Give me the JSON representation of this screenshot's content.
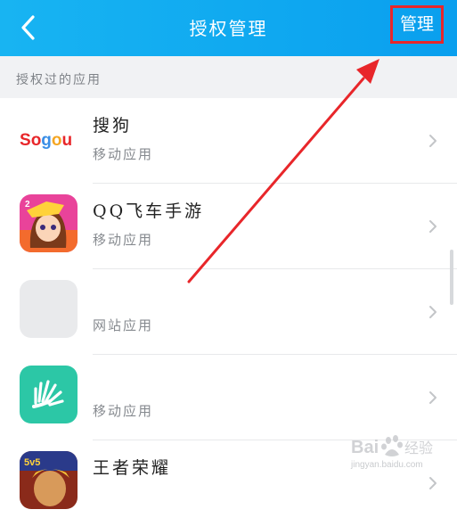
{
  "header": {
    "title": "授权管理",
    "back_icon": "chevron-left-icon",
    "manage_label": "管理"
  },
  "section": {
    "title": "授权过的应用"
  },
  "apps": [
    {
      "name": "搜狗",
      "type": "移动应用",
      "icon": "sogou-logo",
      "logo_text": "Sogou"
    },
    {
      "name": "QQ飞车手游",
      "type": "移动应用",
      "icon": "qq-speed-game-icon"
    },
    {
      "name": "",
      "type": "网站应用",
      "icon": "placeholder-icon"
    },
    {
      "name": "",
      "type": "移动应用",
      "icon": "green-app-icon"
    },
    {
      "name": "王者荣耀",
      "type": "",
      "icon": "honor-of-kings-icon"
    }
  ],
  "watermark": {
    "brand": "Bai",
    "sub": "jingyan.baidu.com"
  },
  "colors": {
    "header_bg": "#12acf0",
    "highlight": "#e8262a",
    "section_bg": "#f1f2f4"
  }
}
